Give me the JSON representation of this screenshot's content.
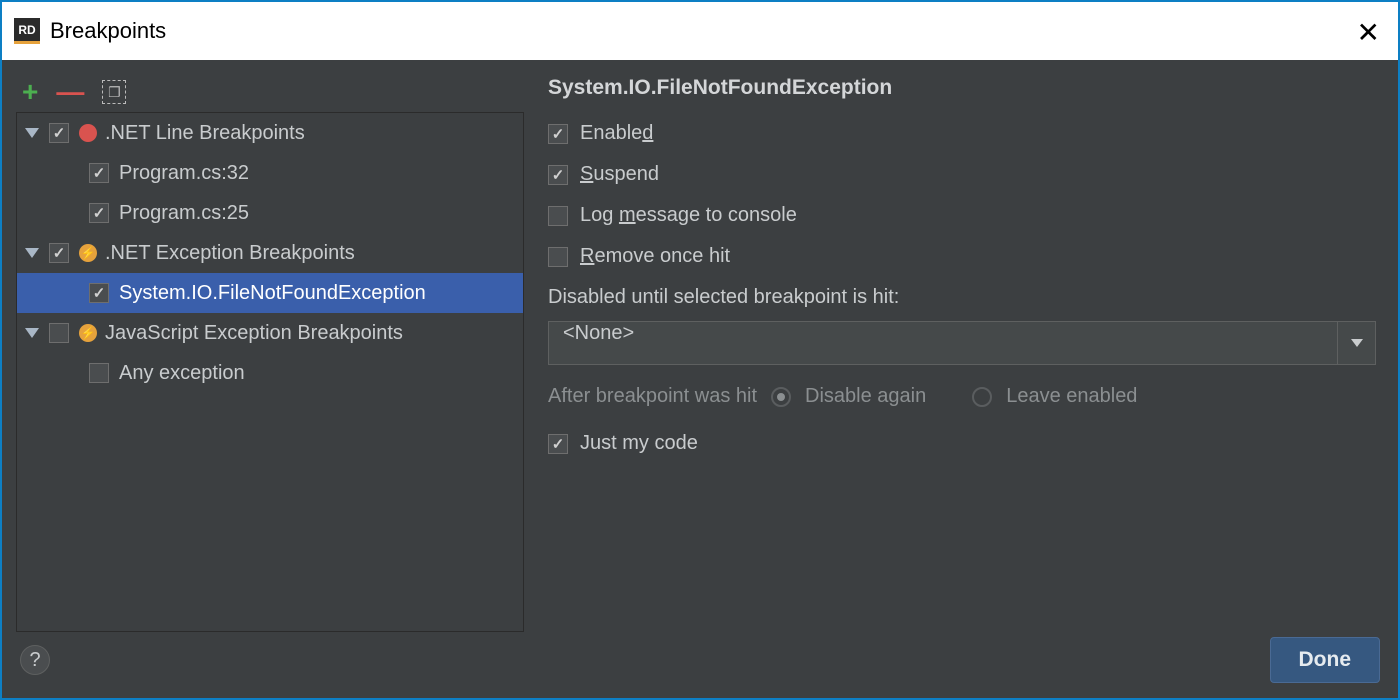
{
  "window": {
    "title": "Breakpoints",
    "app_badge": "RD"
  },
  "toolbar": {
    "add": "+",
    "remove": "—",
    "group": "❐"
  },
  "tree": {
    "groups": [
      {
        "label": ".NET Line Breakpoints",
        "checked": true,
        "icon": "dot",
        "items": [
          {
            "label": "Program.cs:32",
            "checked": true
          },
          {
            "label": "Program.cs:25",
            "checked": true
          }
        ]
      },
      {
        "label": ".NET Exception Breakpoints",
        "checked": true,
        "icon": "bolt",
        "items": [
          {
            "label": "System.IO.FileNotFoundException",
            "checked": true,
            "selected": true
          }
        ]
      },
      {
        "label": "JavaScript Exception Breakpoints",
        "checked": false,
        "icon": "bolt",
        "items": [
          {
            "label": "Any exception",
            "checked": false
          }
        ]
      }
    ]
  },
  "details": {
    "title": "System.IO.FileNotFoundException",
    "enabled_label_pre": "Enable",
    "enabled_label_u": "d",
    "suspend_label_u": "S",
    "suspend_label_post": "uspend",
    "log_label_pre": "Log ",
    "log_label_u": "m",
    "log_label_post": "essage to console",
    "remove_label_u": "R",
    "remove_label_post": "emove once hit",
    "enabled": true,
    "suspend": true,
    "log": false,
    "remove_once": false,
    "disabled_until_label": "Disabled until selected breakpoint is hit:",
    "disabled_until_value": "<None>",
    "after_hit_label": "After breakpoint was hit",
    "radio_disable": "Disable again",
    "radio_leave": "Leave enabled",
    "just_my_code_label": "Just my code",
    "just_my_code": true
  },
  "footer": {
    "help": "?",
    "done": "Done"
  }
}
